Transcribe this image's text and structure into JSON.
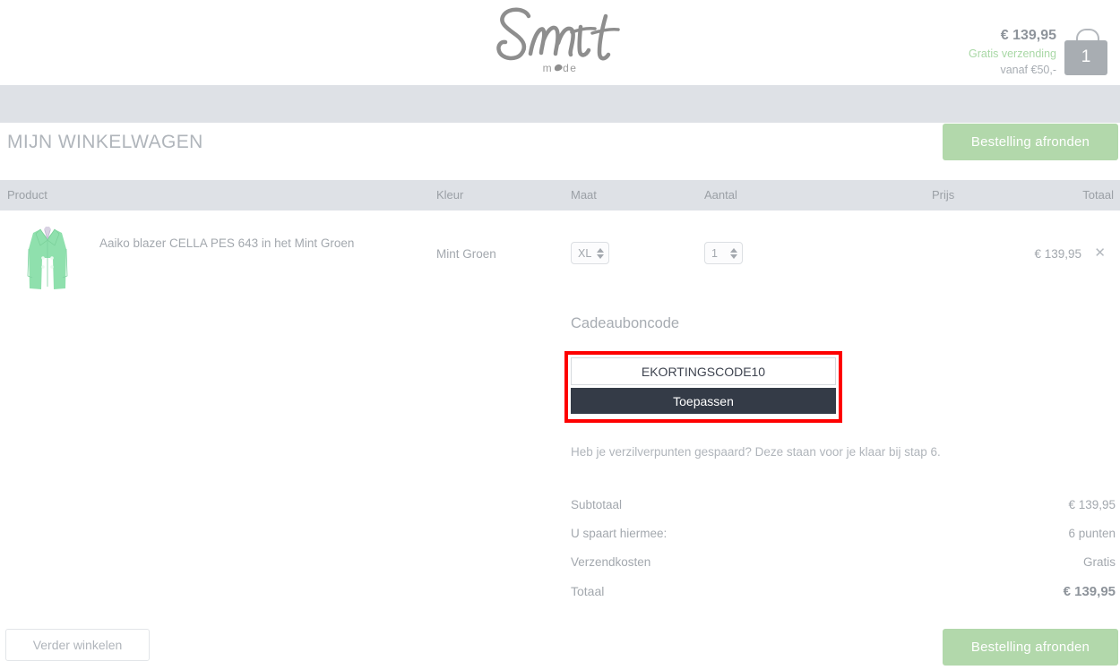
{
  "header": {
    "logo_name": "Smit",
    "logo_sub_before": "m",
    "logo_sub_after": "de",
    "cart": {
      "price": "€ 139,95",
      "free_shipping": "Gratis verzending",
      "from_amount": "vanaf €50,-",
      "item_count": "1"
    }
  },
  "page": {
    "title": "MIJN WINKELWAGEN",
    "checkout_button": "Bestelling afronden",
    "continue_button": "Verder winkelen"
  },
  "table": {
    "headers": {
      "product": "Product",
      "kleur": "Kleur",
      "maat": "Maat",
      "aantal": "Aantal",
      "prijs": "Prijs",
      "totaal": "Totaal"
    },
    "row": {
      "name": "Aaiko blazer CELLA PES 643 in het Mint Groen",
      "color": "Mint Groen",
      "size": "XL",
      "quantity": "1",
      "total": "€ 139,95",
      "remove": "✕"
    }
  },
  "gift": {
    "heading": "Cadeauboncode",
    "code_value": "EKORTINGSCODE10",
    "code_placeholder": "Cadeauboncode",
    "apply_button": "Toepassen",
    "points_note": "Heb je verzilverpunten gespaard? Deze staan voor je klaar bij stap 6."
  },
  "summary": {
    "rows": [
      {
        "label": "Subtotaal",
        "value": "€ 139,95"
      },
      {
        "label": "U spaart hiermee:",
        "value": "6 punten"
      },
      {
        "label": "Verzendkosten",
        "value": "Gratis"
      }
    ],
    "total": {
      "label": "Totaal",
      "value": "€ 139,95"
    }
  },
  "colors": {
    "accent_green": "#b2d8ab",
    "nav_gray": "#dee1e6",
    "dark_button": "#343b47",
    "highlight_red": "#fe0000",
    "product_mint": "#8fe0ad"
  }
}
